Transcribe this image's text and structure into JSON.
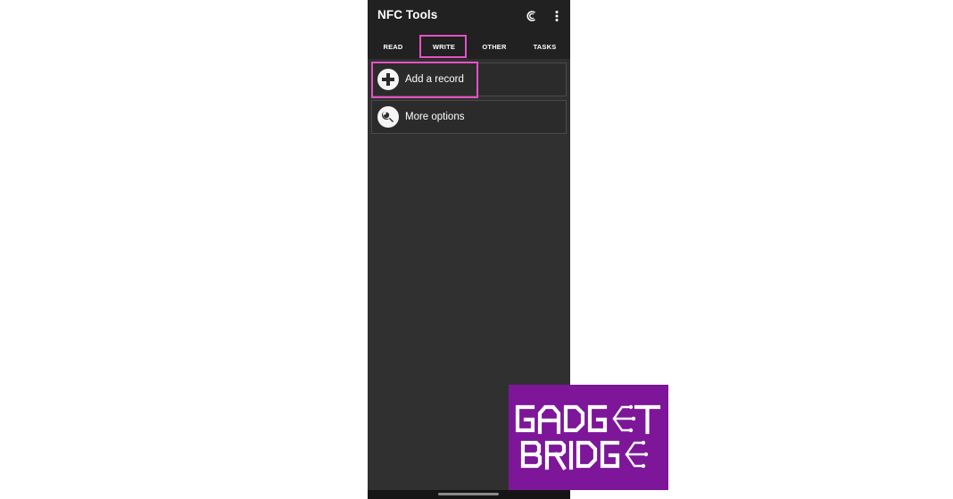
{
  "app": {
    "title": "NFC Tools",
    "icons": [
      "subscription-icon",
      "overflow-menu-icon"
    ]
  },
  "tabs": [
    {
      "label": "READ",
      "active": false
    },
    {
      "label": "WRITE",
      "active": true
    },
    {
      "label": "OTHER",
      "active": false
    },
    {
      "label": "TASKS",
      "active": false
    }
  ],
  "list": {
    "items": [
      {
        "label": "Add a record",
        "icon": "plus-circle-icon"
      },
      {
        "label": "More options",
        "icon": "wrench-icon"
      }
    ]
  },
  "watermark": {
    "line1": "GADGET",
    "line2": "BRIDGE"
  },
  "colors": {
    "highlight": "#e651c6",
    "appbar": "#212121",
    "background": "#303030",
    "watermark": "#7d1699"
  }
}
